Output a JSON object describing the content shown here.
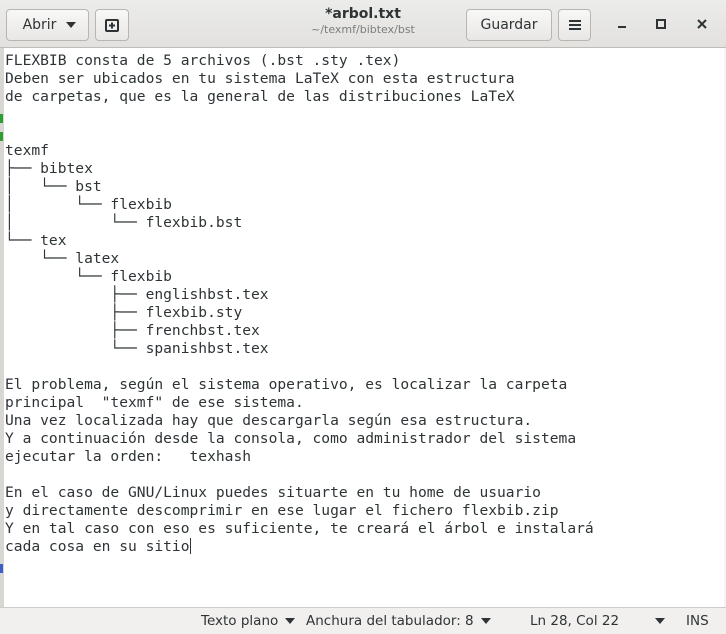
{
  "header": {
    "open_label": "Abrir",
    "title": "*arbol.txt",
    "subtitle": "~/texmf/bibtex/bst",
    "save_label": "Guardar"
  },
  "editor": {
    "lines": [
      "FLEXBIB consta de 5 archivos (.bst .sty .tex)",
      "Deben ser ubicados en tu sistema LaTeX con esta estructura",
      "de carpetas, que es la general de las distribuciones LaTeX",
      "",
      "",
      "texmf",
      "├── bibtex",
      "│   └── bst",
      "│       └── flexbib",
      "│           └── flexbib.bst",
      "└── tex",
      "    └── latex",
      "        └── flexbib",
      "            ├── englishbst.tex",
      "            ├── flexbib.sty",
      "            ├── frenchbst.tex",
      "            └── spanishbst.tex",
      "",
      "El problema, según el sistema operativo, es localizar la carpeta",
      "principal  \"texmf\" de ese sistema.",
      "Una vez localizada hay que descargarla según esa estructura.",
      "Y a continuación desde la consola, como administrador del sistema",
      "ejecutar la orden:   texhash",
      "",
      "En el caso de GNU/Linux puedes situarte en tu home de usuario",
      "y directamente descomprimir en ese lugar el fichero flexbib.zip",
      "Y en tal caso con eso es suficiente, te creará el árbol e instalará",
      "cada cosa en su sitio"
    ]
  },
  "statusbar": {
    "syntax": "Texto plano",
    "tab_width": "Anchura del tabulador: 8",
    "position": "Ln 28, Col 22",
    "mode": "INS"
  },
  "colors": {
    "accent_green": "#2e9e2e",
    "accent_blue": "#3b5fc4"
  }
}
